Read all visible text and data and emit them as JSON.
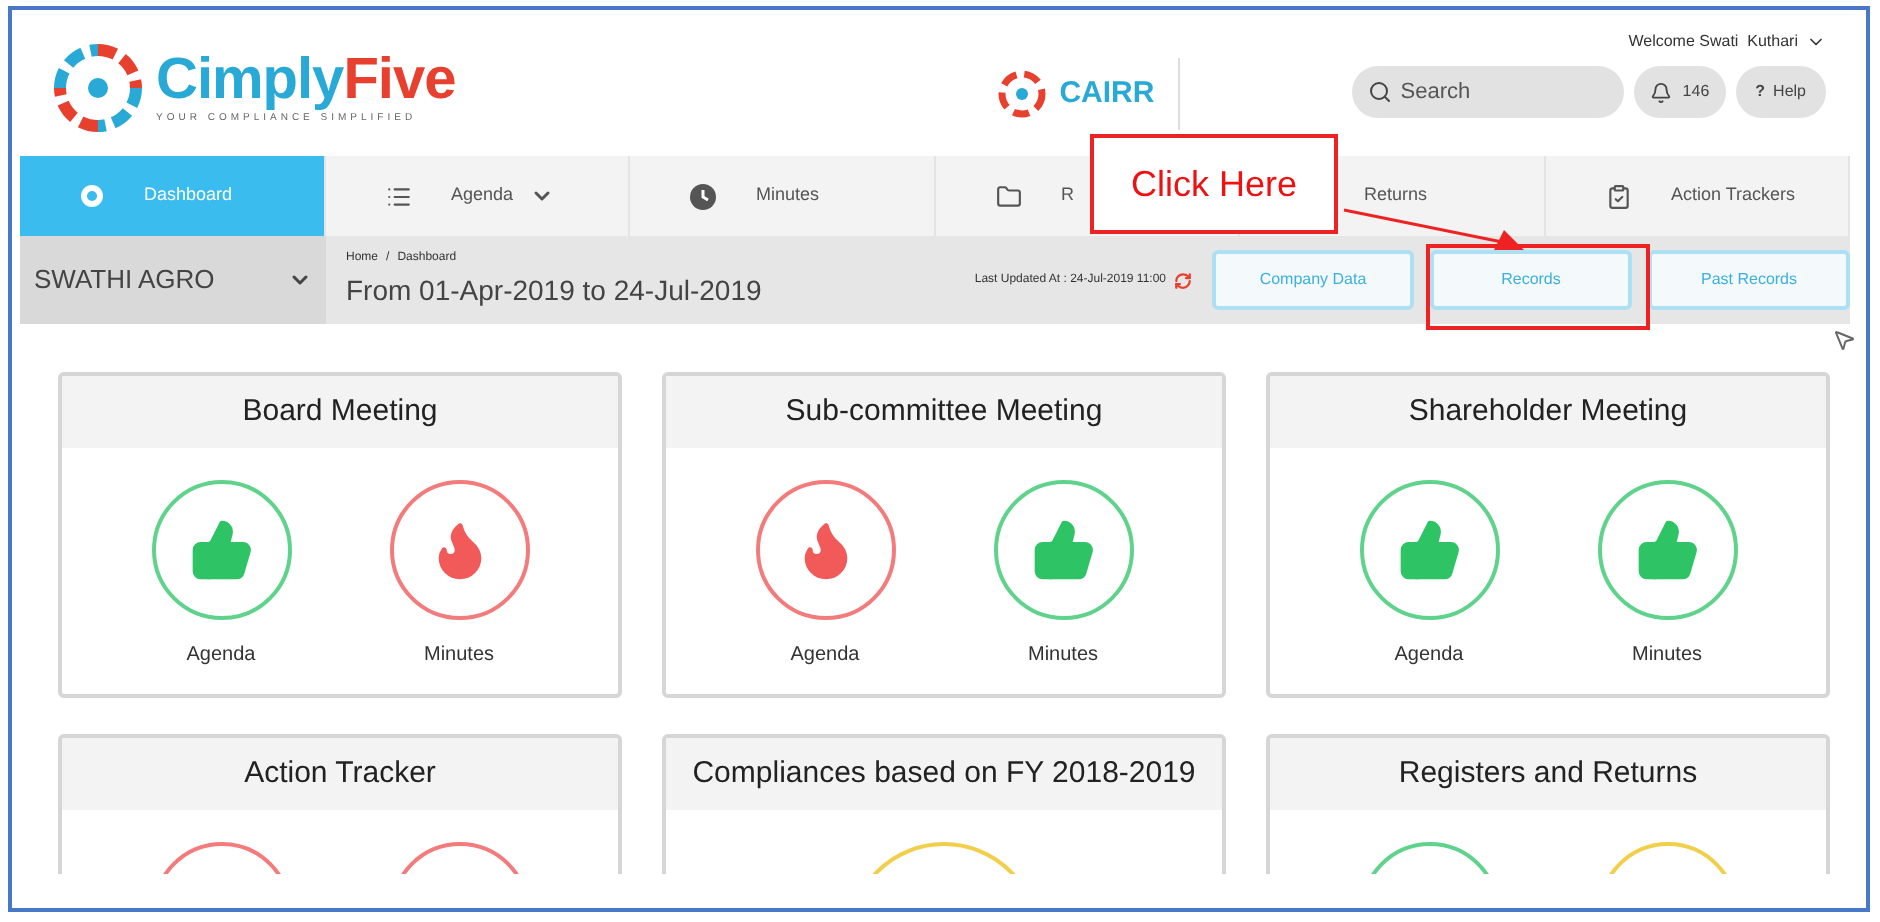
{
  "header": {
    "brand": "Cimply",
    "brand_accent": "Five",
    "tagline": "YOUR COMPLIANCE SIMPLIFIED",
    "product": "CAIRR",
    "welcome": "Welcome Swati  Kuthari",
    "search": {
      "placeholder": "Search"
    },
    "notifications": "146",
    "help_icon": "?",
    "help": "Help"
  },
  "nav": [
    {
      "label": "Dashboard",
      "selected": true,
      "dropdown": false
    },
    {
      "label": "Agenda",
      "selected": false,
      "dropdown": true
    },
    {
      "label": "Minutes",
      "selected": false,
      "dropdown": false
    },
    {
      "label": "R",
      "selected": false,
      "dropdown": false
    },
    {
      "label": "Returns",
      "selected": false,
      "dropdown": false
    },
    {
      "label": "Action Trackers",
      "selected": false,
      "dropdown": false
    }
  ],
  "subbar": {
    "company": "SWATHI AGRO",
    "breadcrumb": [
      "Home",
      "Dashboard"
    ],
    "breadcrumb_separator": "/",
    "period": "From 01-Apr-2019 to 24-Jul-2019",
    "last_updated": "Last Updated At : 24-Jul-2019 11:00",
    "buttons": [
      "Company Data",
      "Records",
      "Past Records"
    ]
  },
  "callout": {
    "text": "Click Here"
  },
  "cards": [
    {
      "title": "Board Meeting",
      "items": [
        {
          "kind": "ok",
          "label": "Agenda"
        },
        {
          "kind": "alert",
          "label": "Minutes"
        }
      ]
    },
    {
      "title": "Sub-committee Meeting",
      "items": [
        {
          "kind": "alert",
          "label": "Agenda"
        },
        {
          "kind": "ok",
          "label": "Minutes"
        }
      ]
    },
    {
      "title": "Shareholder Meeting",
      "items": [
        {
          "kind": "ok",
          "label": "Agenda"
        },
        {
          "kind": "ok",
          "label": "Minutes"
        }
      ]
    },
    {
      "title": "Action Tracker",
      "items": [
        {
          "kind": "alert"
        },
        {
          "kind": "alert"
        }
      ]
    },
    {
      "title": "Compliances based on FY 2018-2019",
      "items": [
        {
          "kind": "pending"
        }
      ]
    },
    {
      "title": "Registers and Returns",
      "items": [
        {
          "kind": "ok"
        },
        {
          "kind": "pending"
        }
      ]
    }
  ]
}
